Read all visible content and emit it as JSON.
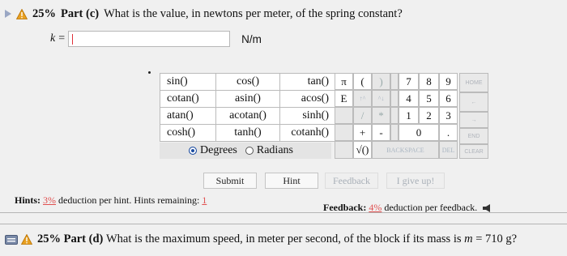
{
  "part_c": {
    "percent": "25%",
    "part_label": "Part (c)",
    "question": "What is the value, in newtons per meter, of the spring constant?"
  },
  "answer": {
    "variable": "k",
    "equals": "=",
    "value": "",
    "unit": "N/m"
  },
  "trig_table": [
    [
      "sin()",
      "cos()",
      "tan()"
    ],
    [
      "cotan()",
      "asin()",
      "acos()"
    ],
    [
      "atan()",
      "acotan()",
      "sinh()"
    ],
    [
      "cosh()",
      "tanh()",
      "cotanh()"
    ]
  ],
  "angle_mode": {
    "degrees_label": "Degrees",
    "radians_label": "Radians",
    "selected": "Degrees"
  },
  "keypad": {
    "pi": "π",
    "open_paren": "(",
    "close_paren": ")",
    "e": "E",
    "up_arrow": "↑^",
    "down_arrow": "^↓",
    "slash": "/",
    "star": "*",
    "plus": "+",
    "minus": "-",
    "sqrt": "√()",
    "backspace": "BACKSPACE",
    "del": "DEL",
    "home": "HOME",
    "end": "END",
    "clear": "CLEAR",
    "left": "←",
    "right": "→",
    "dot": ".",
    "digits": [
      "7",
      "8",
      "9",
      "4",
      "5",
      "6",
      "1",
      "2",
      "3",
      "0"
    ]
  },
  "buttons": {
    "submit": "Submit",
    "hint": "Hint",
    "feedback": "Feedback",
    "give_up": "I give up!"
  },
  "hints_line": {
    "label": "Hints:",
    "percent": "3%",
    "text": "deduction per hint. Hints remaining:",
    "remaining": "1"
  },
  "feedback_line": {
    "label": "Feedback:",
    "percent": "4%",
    "text": "deduction per feedback."
  },
  "part_d": {
    "percent": "25%",
    "part_label": "Part (d)",
    "question": "What is the maximum speed, in meter per second, of the block if its mass is",
    "math_var": "m",
    "math_eq": "=",
    "math_val": "710",
    "math_unit": "g?"
  },
  "colors": {
    "accent_red": "#e05050",
    "warning_orange": "#e8a020",
    "radio_selected": "#1a4ba0"
  }
}
